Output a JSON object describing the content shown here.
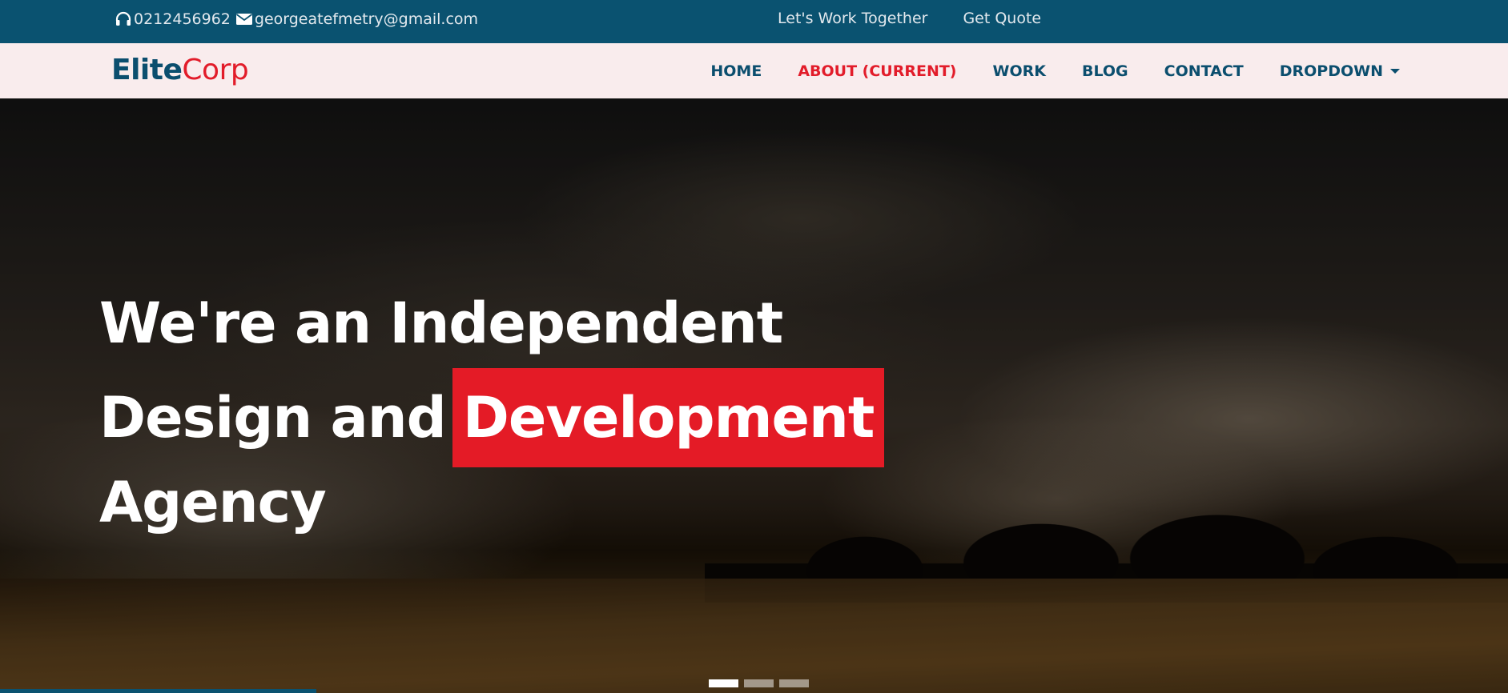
{
  "topbar": {
    "phone": "0212456962",
    "email": "georgeatefmetry@gmail.com",
    "links": [
      "Let's Work Together",
      "Get Quote"
    ]
  },
  "navbar": {
    "brand_part1": "Elite",
    "brand_part2": "Corp",
    "items": [
      "HOME",
      "ABOUT (CURRENT)",
      "WORK",
      "BLOG",
      "CONTACT",
      "DROPDOWN"
    ],
    "active_index": 1
  },
  "hero": {
    "line1": "We're an Independent",
    "line2_plain": "Design and",
    "line2_highlight": "Development",
    "line3": "Agency",
    "carousel_active": 1,
    "carousel_count": 3
  },
  "colors": {
    "topbar_bg": "#0a5270",
    "navbar_bg": "#f9eced",
    "brand_blue": "#0b4e6e",
    "accent_red": "#e21c2a"
  },
  "icons": {
    "phone": "headphones-icon",
    "email": "envelope-icon",
    "dropdown": "caret-down-icon"
  }
}
